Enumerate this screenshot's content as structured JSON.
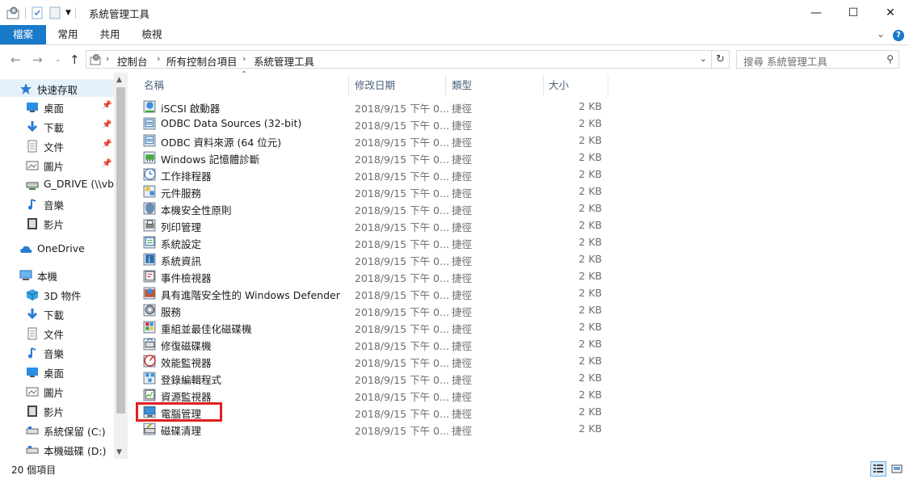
{
  "window": {
    "title": "系統管理工具",
    "minimize": "—",
    "maximize": "☐",
    "close": "✕"
  },
  "ribbon": {
    "tabs": [
      "檔案",
      "常用",
      "共用",
      "檢視"
    ],
    "help": "?"
  },
  "address": {
    "crumbs": [
      "控制台",
      "所有控制台項目",
      "系統管理工具"
    ],
    "search_placeholder": "搜尋 系統管理工具"
  },
  "navpane": {
    "items": [
      {
        "label": "快速存取",
        "icon": "star-icon",
        "selected": true,
        "pinned": false
      },
      {
        "label": "桌面",
        "icon": "desktop-icon",
        "selected": false,
        "pinned": true
      },
      {
        "label": "下載",
        "icon": "download-icon",
        "selected": false,
        "pinned": true
      },
      {
        "label": "文件",
        "icon": "document-icon",
        "selected": false,
        "pinned": true
      },
      {
        "label": "圖片",
        "icon": "pictures-icon",
        "selected": false,
        "pinned": true
      },
      {
        "label": "G_DRIVE (\\\\vbc",
        "icon": "network-drive-icon",
        "selected": false,
        "pinned": false
      },
      {
        "label": "音樂",
        "icon": "music-icon",
        "selected": false,
        "pinned": false
      },
      {
        "label": "影片",
        "icon": "video-icon",
        "selected": false,
        "pinned": false
      },
      {
        "label": "OneDrive",
        "icon": "cloud-icon",
        "selected": false,
        "pinned": false
      },
      {
        "label": "本機",
        "icon": "computer-icon",
        "selected": false,
        "pinned": false
      },
      {
        "label": "3D 物件",
        "icon": "3d-objects-icon",
        "selected": false,
        "pinned": false
      },
      {
        "label": "下載",
        "icon": "download-icon",
        "selected": false,
        "pinned": false
      },
      {
        "label": "文件",
        "icon": "document-icon",
        "selected": false,
        "pinned": false
      },
      {
        "label": "音樂",
        "icon": "music-icon",
        "selected": false,
        "pinned": false
      },
      {
        "label": "桌面",
        "icon": "desktop-icon",
        "selected": false,
        "pinned": false
      },
      {
        "label": "圖片",
        "icon": "pictures-icon",
        "selected": false,
        "pinned": false
      },
      {
        "label": "影片",
        "icon": "video-icon",
        "selected": false,
        "pinned": false
      },
      {
        "label": "系統保留 (C:)",
        "icon": "drive-icon",
        "selected": false,
        "pinned": false
      },
      {
        "label": "本機磁碟 (D:)",
        "icon": "drive-icon",
        "selected": false,
        "pinned": false
      }
    ]
  },
  "columns": {
    "name": "名稱",
    "date": "修改日期",
    "type": "類型",
    "size": "大小"
  },
  "files": [
    {
      "name": "iSCSI 啟動器",
      "date": "2018/9/15 下午 0...",
      "type": "捷徑",
      "size": "2 KB",
      "icon": "iscsi-icon"
    },
    {
      "name": "ODBC Data Sources (32-bit)",
      "date": "2018/9/15 下午 0...",
      "type": "捷徑",
      "size": "2 KB",
      "icon": "odbc-icon"
    },
    {
      "name": "ODBC 資料來源 (64 位元)",
      "date": "2018/9/15 下午 0...",
      "type": "捷徑",
      "size": "2 KB",
      "icon": "odbc-icon"
    },
    {
      "name": "Windows 記憶體診斷",
      "date": "2018/9/15 下午 0...",
      "type": "捷徑",
      "size": "2 KB",
      "icon": "memory-diagnostic-icon"
    },
    {
      "name": "工作排程器",
      "date": "2018/9/15 下午 0...",
      "type": "捷徑",
      "size": "2 KB",
      "icon": "task-scheduler-icon"
    },
    {
      "name": "元件服務",
      "date": "2018/9/15 下午 0...",
      "type": "捷徑",
      "size": "2 KB",
      "icon": "component-services-icon"
    },
    {
      "name": "本機安全性原則",
      "date": "2018/9/15 下午 0...",
      "type": "捷徑",
      "size": "2 KB",
      "icon": "security-policy-icon"
    },
    {
      "name": "列印管理",
      "date": "2018/9/15 下午 0...",
      "type": "捷徑",
      "size": "2 KB",
      "icon": "print-management-icon"
    },
    {
      "name": "系統設定",
      "date": "2018/9/15 下午 0...",
      "type": "捷徑",
      "size": "2 KB",
      "icon": "system-config-icon"
    },
    {
      "name": "系統資訊",
      "date": "2018/9/15 下午 0...",
      "type": "捷徑",
      "size": "2 KB",
      "icon": "system-info-icon"
    },
    {
      "name": "事件檢視器",
      "date": "2018/9/15 下午 0...",
      "type": "捷徑",
      "size": "2 KB",
      "icon": "event-viewer-icon"
    },
    {
      "name": "具有進階安全性的 Windows Defender ...",
      "date": "2018/9/15 下午 0...",
      "type": "捷徑",
      "size": "2 KB",
      "icon": "firewall-icon"
    },
    {
      "name": "服務",
      "date": "2018/9/15 下午 0...",
      "type": "捷徑",
      "size": "2 KB",
      "icon": "services-icon"
    },
    {
      "name": "重組並最佳化磁碟機",
      "date": "2018/9/15 下午 0...",
      "type": "捷徑",
      "size": "2 KB",
      "icon": "defrag-icon"
    },
    {
      "name": "修復磁碟機",
      "date": "2018/9/15 下午 0...",
      "type": "捷徑",
      "size": "2 KB",
      "icon": "recovery-drive-icon"
    },
    {
      "name": "效能監視器",
      "date": "2018/9/15 下午 0...",
      "type": "捷徑",
      "size": "2 KB",
      "icon": "performance-monitor-icon"
    },
    {
      "name": "登錄編輯程式",
      "date": "2018/9/15 下午 0...",
      "type": "捷徑",
      "size": "2 KB",
      "icon": "registry-editor-icon"
    },
    {
      "name": "資源監視器",
      "date": "2018/9/15 下午 0...",
      "type": "捷徑",
      "size": "2 KB",
      "icon": "resource-monitor-icon"
    },
    {
      "name": "電腦管理",
      "date": "2018/9/15 下午 0...",
      "type": "捷徑",
      "size": "2 KB",
      "icon": "computer-management-icon"
    },
    {
      "name": "磁碟清理",
      "date": "2018/9/15 下午 0...",
      "type": "捷徑",
      "size": "2 KB",
      "icon": "disk-cleanup-icon"
    }
  ],
  "status": {
    "item_count": "20 個項目"
  },
  "colors": {
    "accent": "#1979ca",
    "highlight_box": "#e02020",
    "selected_bg": "#e5f1fb"
  }
}
